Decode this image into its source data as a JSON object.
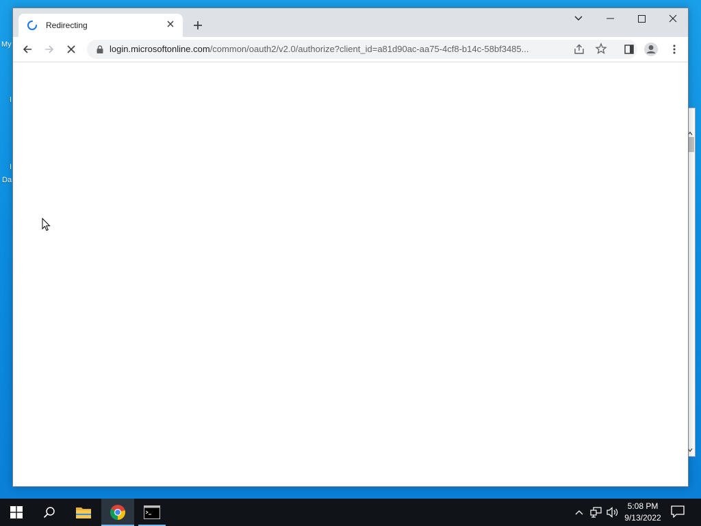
{
  "desktop": {
    "fragments": [
      "My",
      "I",
      "I",
      "Da"
    ]
  },
  "browser": {
    "tab": {
      "title": "Redirecting",
      "close_symbol": "✕"
    },
    "new_tab_symbol": "+",
    "address": {
      "host": "login.microsoftonline.com",
      "path": "/common/oauth2/v2.0/authorize?client_id=a81d90ac-aa75-4cf8-b14c-58bf3485..."
    },
    "accent_color": "#1a73e8"
  },
  "taskbar": {
    "clock": {
      "time": "5:08 PM",
      "date": "9/13/2022"
    },
    "background_color": "#101418"
  },
  "icons": [
    "tab-loading-spinner-icon",
    "close-icon",
    "plus-icon",
    "chevron-down-icon",
    "minimize-icon",
    "maximize-icon",
    "window-close-icon",
    "back-arrow-icon",
    "forward-arrow-icon",
    "stop-loading-icon",
    "lock-icon",
    "share-icon",
    "bookmark-star-icon",
    "side-panel-icon",
    "profile-icon",
    "kebab-menu-icon",
    "windows-logo-icon",
    "search-icon",
    "file-explorer-icon",
    "chrome-icon",
    "command-prompt-icon",
    "tray-chevron-icon",
    "network-icon",
    "volume-icon",
    "notification-icon",
    "mouse-cursor-icon"
  ]
}
